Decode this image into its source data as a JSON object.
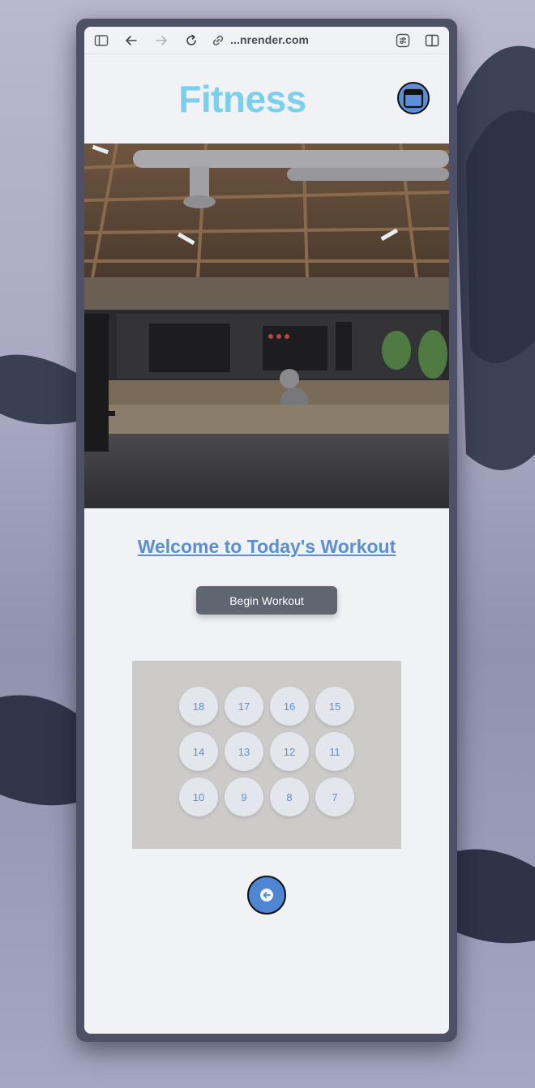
{
  "browser": {
    "url": "...nrender.com"
  },
  "header": {
    "title": "Fitness"
  },
  "main": {
    "welcome": "Welcome to Today's Workout",
    "begin_label": "Begin Workout",
    "days": [
      "18",
      "17",
      "16",
      "15",
      "14",
      "13",
      "12",
      "11",
      "10",
      "9",
      "8",
      "7"
    ]
  },
  "icons": {
    "calendar": "calendar-icon",
    "back": "arrow-left-icon"
  },
  "colors": {
    "title": "#7ad0ec",
    "accent": "#5b8fcf",
    "button": "#5f6672"
  }
}
